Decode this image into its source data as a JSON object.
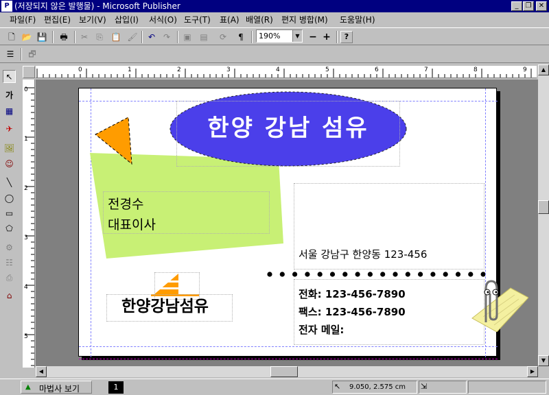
{
  "title_bar": {
    "icon_label": "P",
    "title": "(저장되지 않은 발행물) - Microsoft Publisher",
    "minimize": "_",
    "restore": "❐",
    "close": "✕"
  },
  "menu": [
    "파일(F)",
    "편집(E)",
    "보기(V)",
    "삽입(I)",
    "서식(O)",
    "도구(T)",
    "표(A)",
    "배열(R)",
    "편지 병합(M)",
    "도움말(H)"
  ],
  "toolbar": {
    "zoom_value": "190%",
    "zoom_out": "−",
    "zoom_in": "+",
    "help": "?"
  },
  "toolbox": {
    "text_tool_label": "가"
  },
  "ruler": {
    "h_ticks": [
      "0",
      "1",
      "2",
      "3",
      "4",
      "5",
      "6",
      "7",
      "8",
      "9"
    ],
    "v_ticks": [
      "0",
      "1",
      "2",
      "3",
      "4",
      "5"
    ]
  },
  "card": {
    "company_banner": "한양 강남 섬유",
    "person_name": "전경수",
    "person_title": "대표이사",
    "logo_text": "한양강남섬유",
    "address": "서울 강남구 한양동 123-456",
    "phone": "전화: 123-456-7890",
    "fax": "팩스: 123-456-7890",
    "email": "전자 메일:"
  },
  "colors": {
    "banner_fill": "#4b3fea",
    "accent_green": "#c8f075",
    "accent_orange": "#ff9c00",
    "title_bar": "#000080"
  },
  "status": {
    "master_view": "마법사 보기",
    "page_number": "1",
    "coords": "9.050, 2.575 cm"
  }
}
